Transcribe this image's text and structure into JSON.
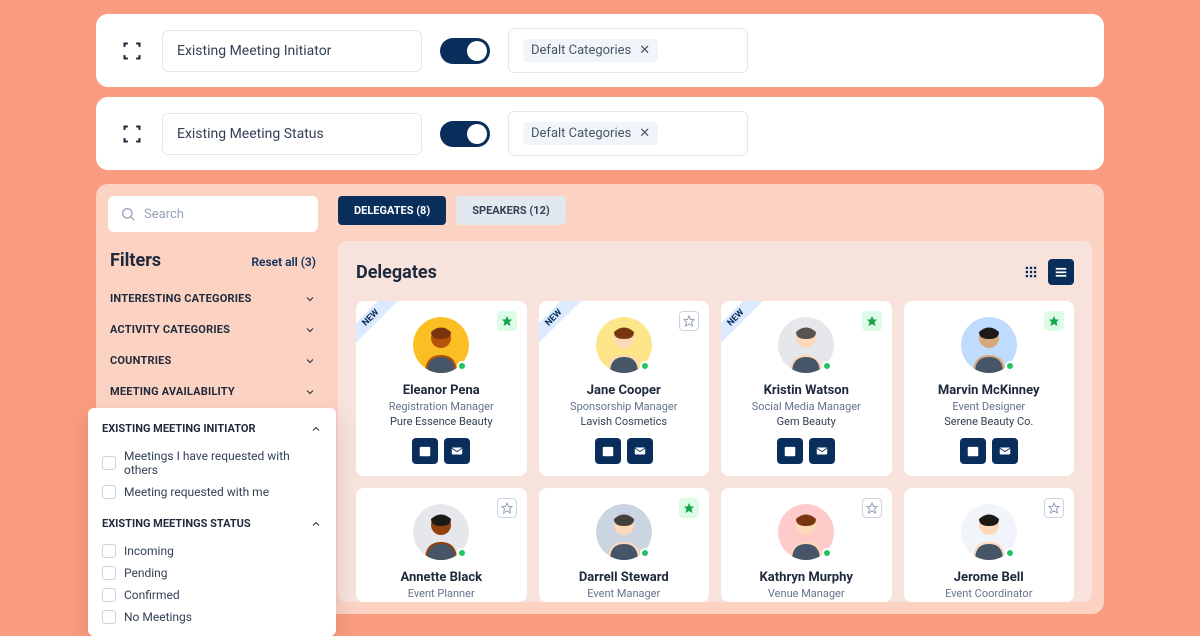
{
  "config_bars": [
    {
      "label": "Existing Meeting Initiator",
      "chip": "Defalt Categories"
    },
    {
      "label": "Existing Meeting Status",
      "chip": "Defalt Categories"
    }
  ],
  "search_placeholder": "Search",
  "filters_title": "Filters",
  "reset_label": "Reset all (3)",
  "filter_sections": [
    "INTERESTING CATEGORIES",
    "ACTIVITY CATEGORIES",
    "COUNTRIES",
    "MEETING AVAILABILITY"
  ],
  "popout": {
    "initiator_title": "EXISTING MEETING INITIATOR",
    "initiator_items": [
      "Meetings I have requested with others",
      "Meeting requested with me"
    ],
    "status_title": "EXISTING MEETINGS STATUS",
    "status_items": [
      "Incoming",
      "Pending",
      "Confirmed",
      "No Meetings"
    ]
  },
  "tabs": [
    {
      "label": "DELEGATES (8)",
      "active": true
    },
    {
      "label": "SPEAKERS (12)",
      "active": false
    }
  ],
  "panel_title": "Delegates",
  "new_label": "NEW",
  "delegates_row1": [
    {
      "name": "Eleanor Pena",
      "role": "Registration Manager",
      "company": "Pure Essence Beauty",
      "new": true,
      "star": "filled",
      "avatar_bg": "#fbbf24",
      "avatar_hair": "#78350f",
      "avatar_skin": "#b45309"
    },
    {
      "name": "Jane Cooper",
      "role": "Sponsorship Manager",
      "company": "Lavish Cosmetics",
      "new": true,
      "star": "outline",
      "avatar_bg": "#fde68a",
      "avatar_hair": "#78350f",
      "avatar_skin": "#fcd9b8"
    },
    {
      "name": "Kristin Watson",
      "role": "Social Media Manager",
      "company": "Gem Beauty",
      "new": true,
      "star": "filled",
      "avatar_bg": "#e5e7eb",
      "avatar_hair": "#57534e",
      "avatar_skin": "#fcd9b8"
    },
    {
      "name": "Marvin McKinney",
      "role": "Event Designer",
      "company": "Serene Beauty Co.",
      "new": false,
      "star": "filled",
      "avatar_bg": "#bfdbfe",
      "avatar_hair": "#1c1917",
      "avatar_skin": "#d6a878"
    }
  ],
  "delegates_row2": [
    {
      "name": "Annette Black",
      "role": "Event Planner",
      "star": "outline",
      "avatar_bg": "#e5e7eb",
      "avatar_hair": "#1c1917",
      "avatar_skin": "#92400e"
    },
    {
      "name": "Darrell Steward",
      "role": "Event Manager",
      "star": "filled",
      "avatar_bg": "#cbd5e1",
      "avatar_hair": "#44403c",
      "avatar_skin": "#fcd9b8"
    },
    {
      "name": "Kathryn Murphy",
      "role": "Venue Manager",
      "star": "outline",
      "avatar_bg": "#fecaca",
      "avatar_hair": "#78350f",
      "avatar_skin": "#fcd9b8"
    },
    {
      "name": "Jerome Bell",
      "role": "Event Coordinator",
      "star": "outline",
      "avatar_bg": "#f1f5f9",
      "avatar_hair": "#1c1917",
      "avatar_skin": "#fcd9b8"
    }
  ]
}
